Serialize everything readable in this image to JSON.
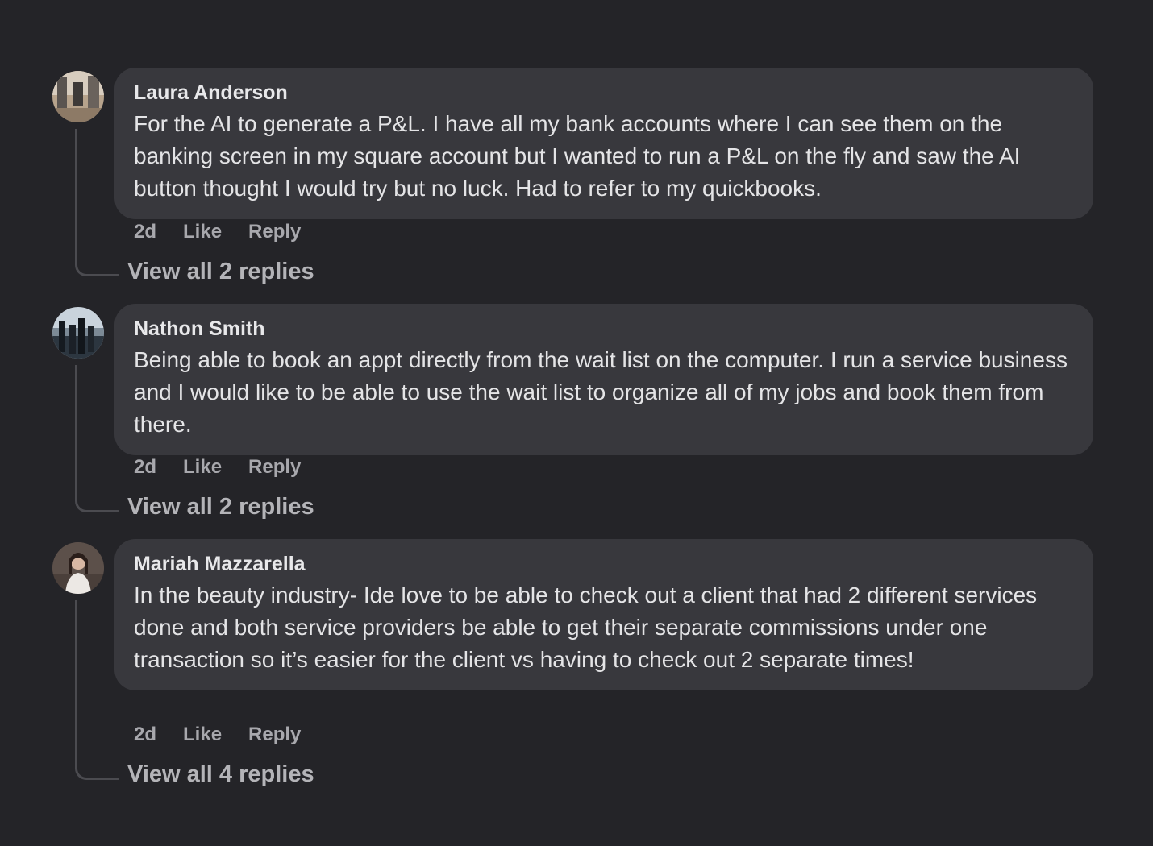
{
  "comments": [
    {
      "author": "Laura Anderson",
      "text": "For the AI to generate a P&L. I have all my bank accounts where I can see them on the banking screen in my square account but I wanted to run a P&L on the fly and saw the AI button thought I would try but no luck. Had to refer to my quickbooks.",
      "time": "2d",
      "like_label": "Like",
      "reply_label": "Reply",
      "view_replies": "View all 2 replies"
    },
    {
      "author": "Nathon Smith",
      "text": "Being able to book an appt directly from the wait list on the computer. I run a service business and I would like to be able to use the wait list to organize all of my jobs and book them from there.",
      "time": "2d",
      "like_label": "Like",
      "reply_label": "Reply",
      "view_replies": "View all 2 replies"
    },
    {
      "author": "Mariah Mazzarella",
      "text": "In the beauty industry- Ide love to be able to check out a client that had 2 different services done and both service providers be able to get their separate commissions under one transaction so it’s easier for the client vs having to check out 2 separate times!",
      "time": "2d",
      "like_label": "Like",
      "reply_label": "Reply",
      "view_replies": "View all 4 replies"
    }
  ],
  "colors": {
    "background": "#242428",
    "bubble": "#38383d",
    "thread_line": "#4b4b50",
    "meta_text": "#a8a8ad"
  }
}
